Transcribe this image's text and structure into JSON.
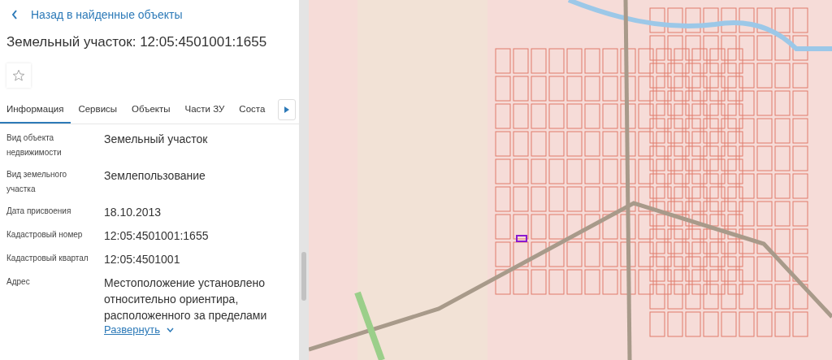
{
  "back_link": {
    "label": "Назад в найденные объекты"
  },
  "title": "Земельный участок: 12:05:4501001:1655",
  "favorite": {
    "on": false
  },
  "tabs": [
    {
      "label": "Информация",
      "selected": true
    },
    {
      "label": "Сервисы",
      "selected": false
    },
    {
      "label": "Объекты",
      "selected": false
    },
    {
      "label": "Части ЗУ",
      "selected": false
    },
    {
      "label": "Соста",
      "selected": false
    }
  ],
  "fields": [
    {
      "label": "Вид объекта недвижимости",
      "value": "Земельный участок"
    },
    {
      "label": "Вид земельного участка",
      "value": "Землепользование"
    },
    {
      "label": "Дата присвоения",
      "value": "18.10.2013"
    },
    {
      "label": "Кадастровый номер",
      "value": "12:05:4501001:1655"
    },
    {
      "label": "Кадастровый квартал",
      "value": "12:05:4501001"
    },
    {
      "label": "Адрес",
      "value": "Местоположение установлено относительно ориентира, расположенного за пределами",
      "expand_link": "Развернуть"
    }
  ]
}
